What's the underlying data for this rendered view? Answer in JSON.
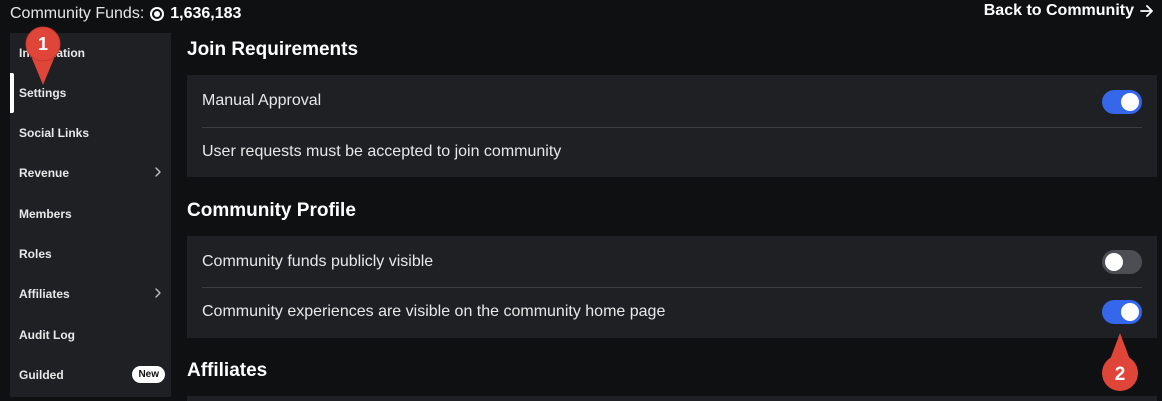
{
  "header": {
    "funds_label": "Community Funds:",
    "funds_value": "1,636,183",
    "back_label": "Back to Community"
  },
  "sidebar": {
    "items": [
      {
        "label": "Information",
        "active": false
      },
      {
        "label": "Settings",
        "active": true
      },
      {
        "label": "Social Links",
        "active": false
      },
      {
        "label": "Revenue",
        "active": false,
        "has_chevron": true
      },
      {
        "label": "Members",
        "active": false
      },
      {
        "label": "Roles",
        "active": false
      },
      {
        "label": "Affiliates",
        "active": false,
        "has_chevron": true
      },
      {
        "label": "Audit Log",
        "active": false
      },
      {
        "label": "Guilded",
        "active": false,
        "badge": "New"
      }
    ]
  },
  "sections": {
    "join": {
      "title": "Join Requirements",
      "manual_approval_label": "Manual Approval",
      "manual_approval_on": true,
      "description": "User requests must be accepted to join community"
    },
    "profile": {
      "title": "Community Profile",
      "funds_visible_label": "Community funds publicly visible",
      "funds_visible_on": false,
      "experiences_visible_label": "Community experiences are visible on the community home page",
      "experiences_visible_on": true
    },
    "affiliates": {
      "title": "Affiliates"
    }
  },
  "annotations": {
    "marker1": "1",
    "marker2": "2"
  },
  "colors": {
    "page_bg": "#0f1012",
    "panel_bg": "#1e2024",
    "toggle_on": "#3567ea",
    "toggle_off": "#4c4e54",
    "marker": "#e0453a"
  }
}
